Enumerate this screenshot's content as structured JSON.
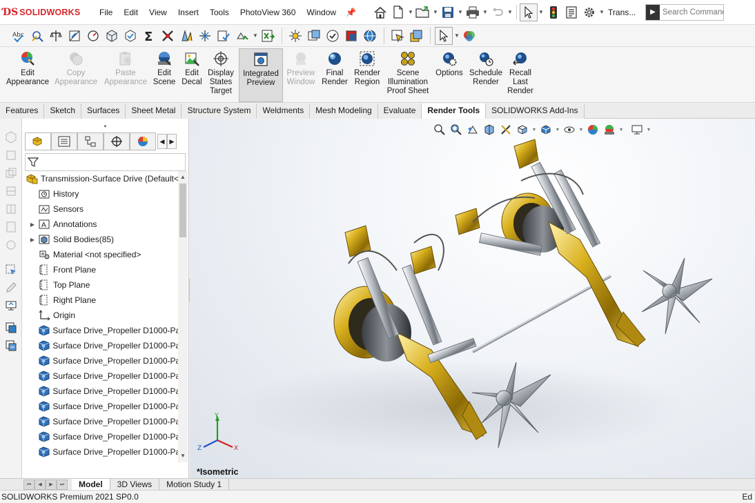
{
  "app": {
    "brand": "SOLIDWORKS",
    "logo_prefix": "DS"
  },
  "menu": [
    "File",
    "Edit",
    "View",
    "Insert",
    "Tools",
    "PhotoView 360",
    "Window"
  ],
  "quick_access": {
    "document_label": "Trans...",
    "search_placeholder": "Search Command"
  },
  "ribbon": {
    "buttons": [
      {
        "label": "Edit\nAppearance",
        "enabled": true
      },
      {
        "label": "Copy\nAppearance",
        "enabled": false
      },
      {
        "label": "Paste\nAppearance",
        "enabled": false
      },
      {
        "label": "Edit\nScene",
        "enabled": true
      },
      {
        "label": "Edit\nDecal",
        "enabled": true
      },
      {
        "label": "Display\nStates\nTarget",
        "enabled": true
      },
      {
        "label": "Integrated\nPreview",
        "enabled": true,
        "active": true
      },
      {
        "label": "Preview\nWindow",
        "enabled": false
      },
      {
        "label": "Final\nRender",
        "enabled": true
      },
      {
        "label": "Render\nRegion",
        "enabled": true
      },
      {
        "label": "Scene\nIllumination\nProof Sheet",
        "enabled": true
      },
      {
        "label": "Options",
        "enabled": true
      },
      {
        "label": "Schedule\nRender",
        "enabled": true
      },
      {
        "label": "Recall\nLast\nRender",
        "enabled": true
      }
    ]
  },
  "command_tabs": [
    "Features",
    "Sketch",
    "Surfaces",
    "Sheet Metal",
    "Structure System",
    "Weldments",
    "Mesh Modeling",
    "Evaluate",
    "Render Tools",
    "SOLIDWORKS Add-Ins"
  ],
  "command_tab_selected": "Render Tools",
  "feature_tree": {
    "root": "Transmission-Surface Drive  (Default<",
    "items": [
      {
        "label": "History",
        "icon": "history-icon",
        "expandable": false
      },
      {
        "label": "Sensors",
        "icon": "sensors-icon",
        "expandable": false
      },
      {
        "label": "Annotations",
        "icon": "annotations-icon",
        "expandable": true
      },
      {
        "label": "Solid Bodies(85)",
        "icon": "solid-bodies-icon",
        "expandable": true
      },
      {
        "label": "Material <not specified>",
        "icon": "material-icon",
        "expandable": false
      },
      {
        "label": "Front Plane",
        "icon": "plane-icon",
        "expandable": false
      },
      {
        "label": "Top Plane",
        "icon": "plane-icon",
        "expandable": false
      },
      {
        "label": "Right Plane",
        "icon": "plane-icon",
        "expandable": false
      },
      {
        "label": "Origin",
        "icon": "origin-icon",
        "expandable": false
      },
      {
        "label": "Surface Drive_Propeller D1000-Pa",
        "icon": "part-icon",
        "expandable": false
      },
      {
        "label": "Surface Drive_Propeller D1000-Pa",
        "icon": "part-icon",
        "expandable": false
      },
      {
        "label": "Surface Drive_Propeller D1000-Pa",
        "icon": "part-icon",
        "expandable": false
      },
      {
        "label": "Surface Drive_Propeller D1000-Pa",
        "icon": "part-icon",
        "expandable": false
      },
      {
        "label": "Surface Drive_Propeller D1000-Pa",
        "icon": "part-icon",
        "expandable": false
      },
      {
        "label": "Surface Drive_Propeller D1000-Pa",
        "icon": "part-icon",
        "expandable": false
      },
      {
        "label": "Surface Drive_Propeller D1000-Pa",
        "icon": "part-icon",
        "expandable": false
      },
      {
        "label": "Surface Drive_Propeller D1000-Pa",
        "icon": "part-icon",
        "expandable": false
      },
      {
        "label": "Surface Drive_Propeller D1000-Pa",
        "icon": "part-icon",
        "expandable": false
      }
    ]
  },
  "graphics": {
    "view_label": "*Isometric",
    "triad": {
      "x": "X",
      "y": "Y",
      "z": "Z"
    },
    "colors": {
      "gold": "#c9a21a",
      "steel": "#b9bec4",
      "axis_x": "#d42020",
      "axis_y": "#2a9a2a",
      "axis_z": "#2050c8"
    }
  },
  "bottom_tabs": [
    "Model",
    "3D Views",
    "Motion Study 1"
  ],
  "bottom_tab_selected": "Model",
  "status": {
    "left": "SOLIDWORKS Premium 2021 SP0.0",
    "right": "Ed"
  }
}
